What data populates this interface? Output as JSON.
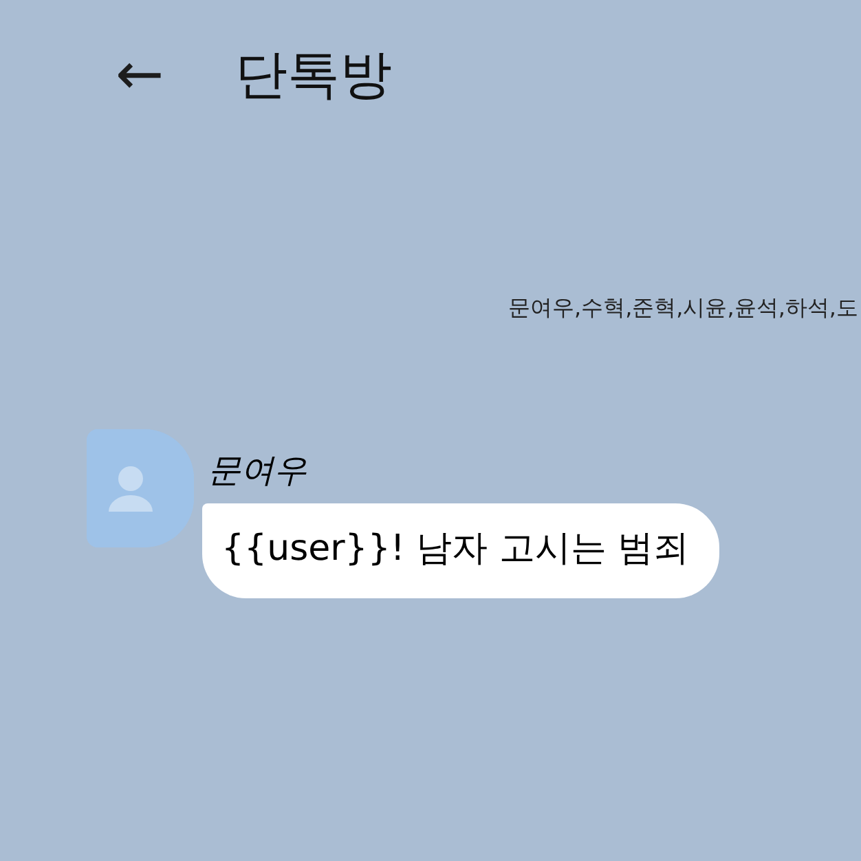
{
  "header": {
    "back": "←",
    "title": "단톡방"
  },
  "members": "문여우,수혁,준혁,시윤,윤석,하석,도",
  "messages": [
    {
      "sender": "문여우",
      "text": "{{user}}! 남자 고시는 범죄"
    }
  ]
}
